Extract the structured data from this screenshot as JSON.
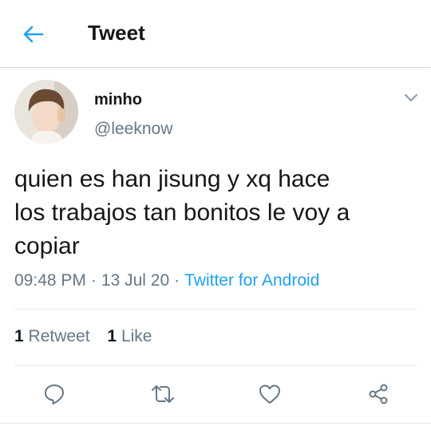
{
  "header": {
    "back_icon": "arrow-left-icon",
    "title": "Tweet"
  },
  "tweet": {
    "author_name": "minho",
    "author_handle": "@leeknow",
    "text_lines": [
      "quien es han jisung y xq hace",
      "los trabajos tan bonitos le voy a",
      "copiar"
    ],
    "time": "09:48 PM",
    "date": "13 Jul 20",
    "source": "Twitter for Android",
    "separator": "·"
  },
  "stats": {
    "retweets_count": "1",
    "retweets_label": "Retweet",
    "likes_count": "1",
    "likes_label": "Like"
  },
  "actions": [
    "reply-icon",
    "retweet-icon",
    "like-icon",
    "share-icon"
  ],
  "colors": {
    "accent": "#1da1f2",
    "text": "#14171a",
    "secondary": "#657786",
    "divider": "#e1e8ed"
  }
}
